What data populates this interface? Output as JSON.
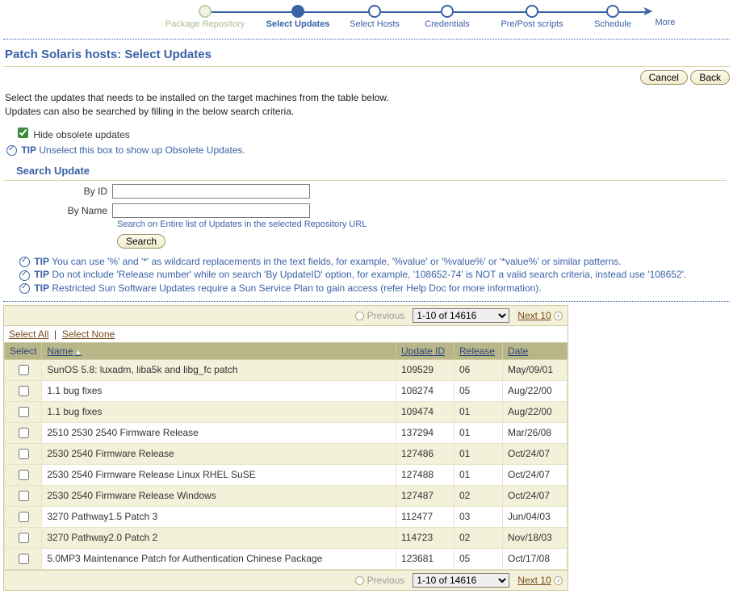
{
  "wizard": {
    "steps": [
      {
        "label": "Package Repository",
        "state": "done"
      },
      {
        "label": "Select Updates",
        "state": "current"
      },
      {
        "label": "Select Hosts",
        "state": "todo"
      },
      {
        "label": "Credentials",
        "state": "todo"
      },
      {
        "label": "Pre/Post scripts",
        "state": "todo"
      },
      {
        "label": "Schedule",
        "state": "todo"
      }
    ],
    "more": "More"
  },
  "title": "Patch Solaris hosts: Select Updates",
  "buttons": {
    "cancel": "Cancel",
    "back": "Back"
  },
  "intro_line1": "Select the updates that needs to be installed on the target machines from the table below.",
  "intro_line2": "Updates can also be searched by filling in the below search criteria.",
  "hide_obsolete": {
    "label": "Hide obsolete updates",
    "checked": true
  },
  "tip_obsolete": {
    "prefix": "TIP",
    "text": "Unselect this box to show up Obsolete Updates."
  },
  "search": {
    "header": "Search Update",
    "by_id": "By ID",
    "by_name": "By Name",
    "id_value": "",
    "name_value": "",
    "hint": "Search on Entire list of Updates in the selected Repository URL",
    "button": "Search"
  },
  "tips": [
    "You can use '%' and '*' as wildcard replacements in the text fields, for example, '%value' or '%value%' or '*value%' or similar patterns.",
    "Do not include 'Release number' while on search 'By UpdateID' option, for example, '108652-74' is NOT a valid search criteria, instead use '108652'.",
    "Restricted Sun Software Updates require a Sun Service Plan to gain access (refer Help Doc for more information)."
  ],
  "tip_word": "TIP",
  "pager": {
    "previous": "Previous",
    "range": "1-10 of 14616",
    "next": "Next 10"
  },
  "selbar": {
    "select_all": "Select All",
    "select_none": "Select None"
  },
  "columns": {
    "select": "Select",
    "name": "Name",
    "update_id": "Update ID",
    "release": "Release",
    "date": "Date"
  },
  "rows": [
    {
      "name": "SunOS 5.8: luxadm, liba5k and libg_fc patch",
      "update_id": "109529",
      "release": "06",
      "date": "May/09/01"
    },
    {
      "name": "1.1 bug fixes",
      "update_id": "108274",
      "release": "05",
      "date": "Aug/22/00"
    },
    {
      "name": "1.1 bug fixes",
      "update_id": "109474",
      "release": "01",
      "date": "Aug/22/00"
    },
    {
      "name": "2510 2530 2540 Firmware Release",
      "update_id": "137294",
      "release": "01",
      "date": "Mar/26/08"
    },
    {
      "name": "2530 2540 Firmware Release",
      "update_id": "127486",
      "release": "01",
      "date": "Oct/24/07"
    },
    {
      "name": "2530 2540 Firmware Release Linux RHEL SuSE",
      "update_id": "127488",
      "release": "01",
      "date": "Oct/24/07"
    },
    {
      "name": "2530 2540 Firmware Release Windows",
      "update_id": "127487",
      "release": "02",
      "date": "Oct/24/07"
    },
    {
      "name": "3270 Pathway1.5 Patch 3",
      "update_id": "112477",
      "release": "03",
      "date": "Jun/04/03"
    },
    {
      "name": "3270 Pathway2.0 Patch 2",
      "update_id": "114723",
      "release": "02",
      "date": "Nov/18/03"
    },
    {
      "name": "5.0MP3 Maintenance Patch for Authentication Chinese Package",
      "update_id": "123681",
      "release": "05",
      "date": "Oct/17/08"
    }
  ]
}
